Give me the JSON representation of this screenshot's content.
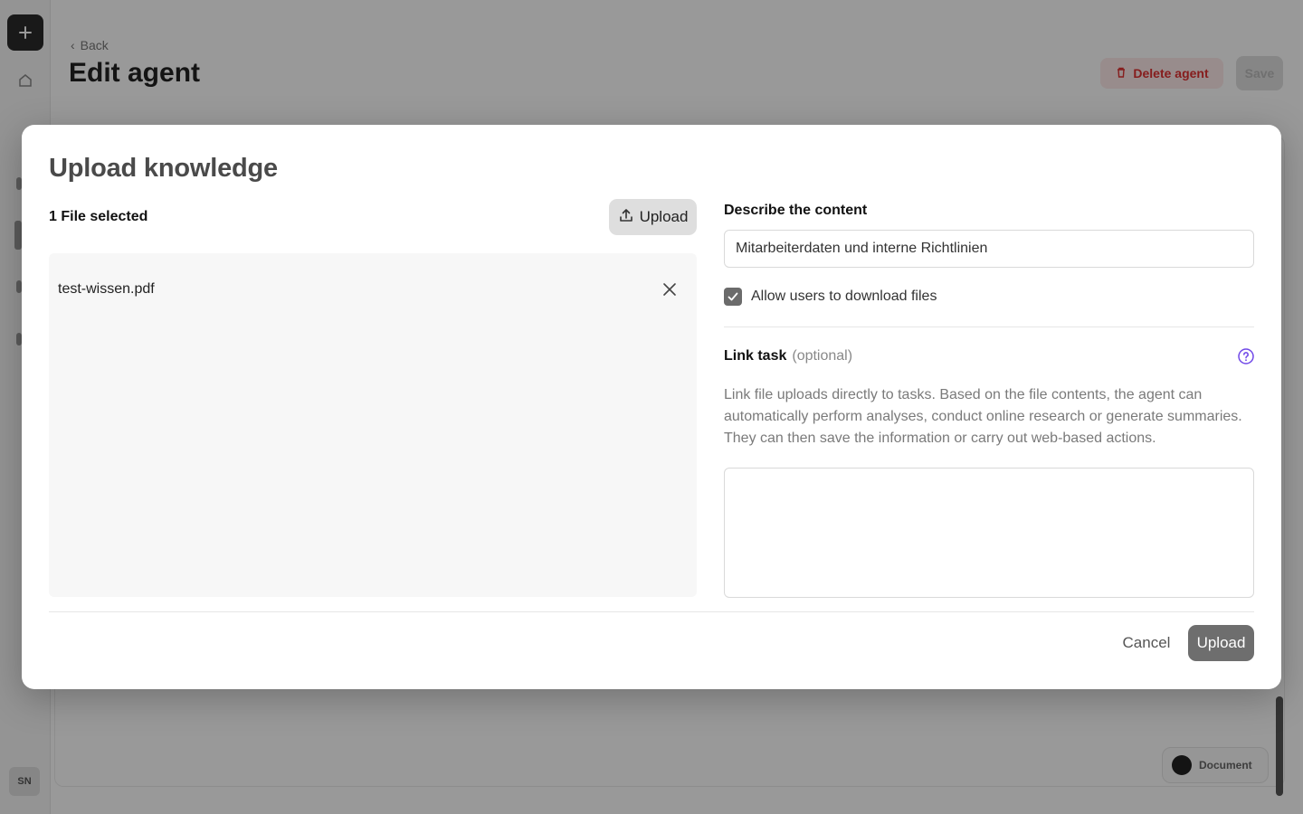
{
  "background": {
    "back_label": "Back",
    "page_title": "Edit agent",
    "delete_label": "Delete agent",
    "save_label": "Save",
    "avatar_initials": "SN",
    "doc_pill_label": "Document"
  },
  "modal": {
    "title": "Upload knowledge",
    "file_count": "1 File selected",
    "upload_top_label": "Upload",
    "files": [
      {
        "name": "test-wissen.pdf"
      }
    ],
    "describe_label": "Describe the content",
    "describe_value": "Mitarbeiterdaten und interne Richtlinien",
    "allow_download_label": "Allow users to download files",
    "allow_download_checked": true,
    "link_task_label": "Link task",
    "link_task_optional": "(optional)",
    "link_task_description": "Link file uploads directly to tasks. Based on the file contents, the agent can automatically perform analyses, conduct online research or generate summaries. They can then save the information or carry out web-based actions.",
    "task_value": "",
    "cancel_label": "Cancel",
    "upload_label": "Upload"
  },
  "colors": {
    "help_icon": "#7048e8",
    "primary_button": "#6e6e6e",
    "delete_red": "#e03131"
  }
}
